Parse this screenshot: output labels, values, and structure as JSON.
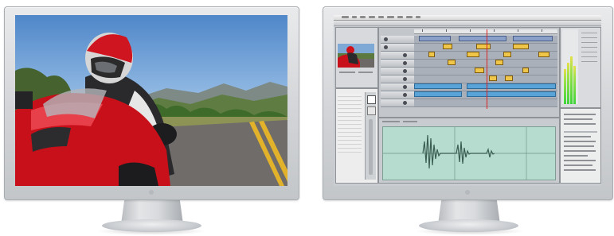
{
  "scene": {
    "description_colors": {
      "accent": "#d0101a",
      "sky": "#6aa0d8"
    }
  },
  "left_monitor": {
    "content": "motorcycle-rider-video-frame",
    "logo": "apple-logo"
  },
  "right_monitor": {
    "content": "video-editing-application",
    "logo": "apple-logo",
    "menubar": {
      "apple_icon": ""
    },
    "timeline_colors": {
      "video_clip": "#8aa0c9",
      "audio_clip": "#58a4d8",
      "title_clip": "#f0c64a",
      "playhead": "#dd2222"
    }
  }
}
